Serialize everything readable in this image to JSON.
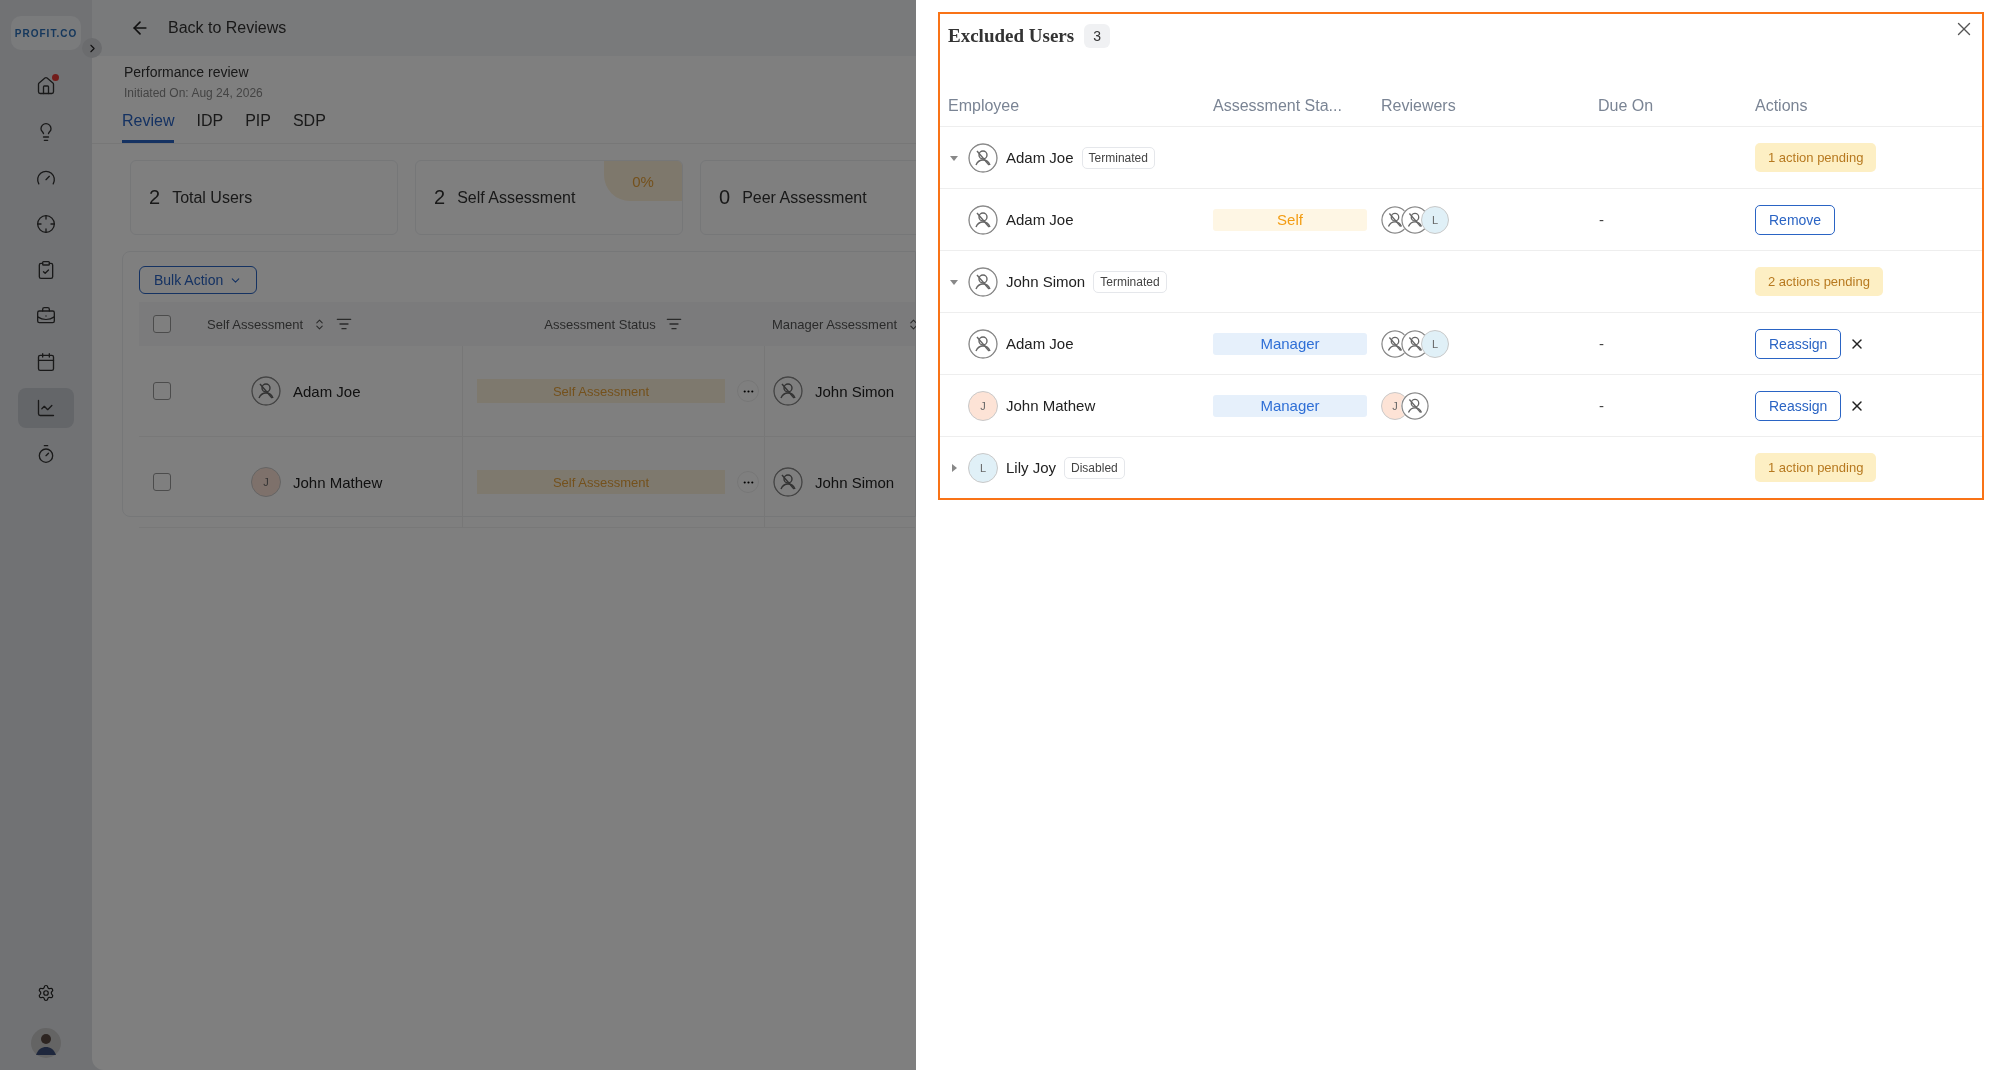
{
  "sidebar": {
    "logo": "PROFIT.CO",
    "items": [
      {
        "kind": "home",
        "selected": false,
        "notification": true
      },
      {
        "kind": "idea",
        "selected": false,
        "notification": false
      },
      {
        "kind": "gauge",
        "selected": false,
        "notification": false
      },
      {
        "kind": "target",
        "selected": false,
        "notification": false
      },
      {
        "kind": "tasks",
        "selected": false,
        "notification": false
      },
      {
        "kind": "briefcase",
        "selected": false,
        "notification": false
      },
      {
        "kind": "calendar",
        "selected": false,
        "notification": false
      },
      {
        "kind": "chart",
        "selected": true,
        "notification": false
      },
      {
        "kind": "timer",
        "selected": false,
        "notification": false
      }
    ]
  },
  "header": {
    "back_link": "Back to Reviews",
    "review_type": "Performance review",
    "initiated": "Initiated On: Aug 24, 2026"
  },
  "tabs": [
    {
      "label": "Review",
      "selected": true
    },
    {
      "label": "IDP",
      "selected": false
    },
    {
      "label": "PIP",
      "selected": false
    },
    {
      "label": "SDP",
      "selected": false
    }
  ],
  "stats": [
    {
      "count": "2",
      "label": "Total Users"
    },
    {
      "count": "2",
      "label": "Self Assessment",
      "percent": "0%"
    },
    {
      "count": "0",
      "label": "Peer Assessment"
    }
  ],
  "bulk_action": "Bulk Action",
  "table": {
    "columns": [
      "Self Assessment",
      "Assessment Status",
      "Manager Assessment"
    ],
    "select_all": {
      "checked": false
    },
    "rows": [
      {
        "checked": false,
        "employee": "Adam Joe",
        "avatar": {
          "kind": "placeholder"
        },
        "status": "Self Assessment",
        "manager": "John Simon"
      },
      {
        "checked": false,
        "employee": "John Mathew",
        "avatar": {
          "kind": "initial",
          "letter": "J"
        },
        "status": "Self Assessment",
        "manager": "John Simon"
      }
    ]
  },
  "panel": {
    "title": "Excluded Users",
    "count": "3",
    "columns": [
      "Employee",
      "Assessment Sta...",
      "Reviewers",
      "Due On",
      "Actions"
    ],
    "groups": [
      {
        "name": "Adam Joe",
        "avatar": {
          "kind": "placeholder"
        },
        "tag": "Terminated",
        "pending": "1 action pending",
        "expanded": true,
        "children": [
          {
            "name": "Adam Joe",
            "avatar": {
              "kind": "placeholder"
            },
            "status": {
              "label": "Self",
              "kind": "self"
            },
            "reviewers": [
              {
                "kind": "placeholder"
              },
              {
                "kind": "placeholder"
              },
              {
                "kind": "initial",
                "letter": "L",
                "color": "#e0f0f7"
              }
            ],
            "due": "-",
            "action": "Remove",
            "dismissible": false
          }
        ]
      },
      {
        "name": "John Simon",
        "avatar": {
          "kind": "placeholder"
        },
        "tag": "Terminated",
        "pending": "2 actions pending",
        "expanded": true,
        "children": [
          {
            "name": "Adam Joe",
            "avatar": {
              "kind": "placeholder"
            },
            "status": {
              "label": "Manager",
              "kind": "manager"
            },
            "reviewers": [
              {
                "kind": "placeholder"
              },
              {
                "kind": "placeholder"
              },
              {
                "kind": "initial",
                "letter": "L",
                "color": "#e0f0f7"
              }
            ],
            "due": "-",
            "action": "Reassign",
            "dismissible": true
          },
          {
            "name": "John Mathew",
            "avatar": {
              "kind": "initial",
              "letter": "J",
              "color": "#fde3d6"
            },
            "status": {
              "label": "Manager",
              "kind": "manager"
            },
            "reviewers": [
              {
                "kind": "initial",
                "letter": "J",
                "color": "#fde3d6"
              },
              {
                "kind": "placeholder"
              }
            ],
            "due": "-",
            "action": "Reassign",
            "dismissible": true
          }
        ]
      },
      {
        "name": "Lily Joy",
        "avatar": {
          "kind": "initial",
          "letter": "L",
          "color": "#e0f0f7"
        },
        "tag": "Disabled",
        "pending": "1 action pending",
        "expanded": false
      }
    ]
  }
}
